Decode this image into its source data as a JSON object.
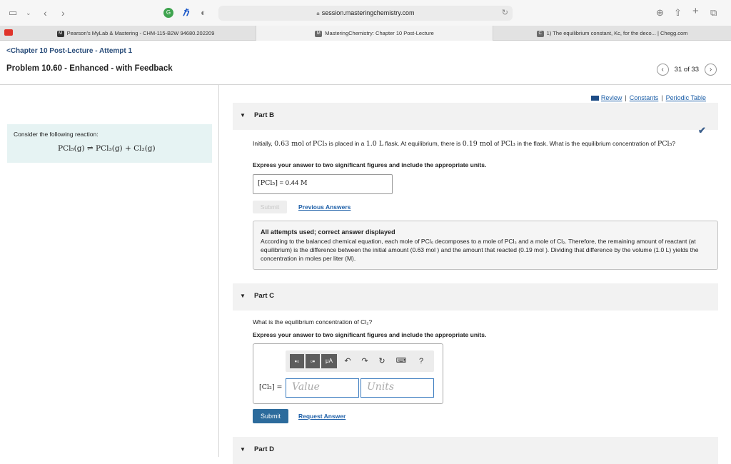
{
  "browser": {
    "url": "session.masteringchemistry.com",
    "tabs": [
      {
        "badge": "M",
        "label": "Pearson's MyLab & Mastering - CHM-115-B2W 94680.202209"
      },
      {
        "badge": "M",
        "label": "MasteringChemistry: Chapter 10 Post-Lecture"
      },
      {
        "badge": "C",
        "label": "1) The equilibrium constant, Kc, for the deco... | Chegg.com"
      }
    ]
  },
  "header": {
    "breadcrumb": "<Chapter 10 Post-Lecture - Attempt 1",
    "title": "Problem 10.60 - Enhanced - with Feedback",
    "pager": "31 of 33"
  },
  "intro": {
    "text": "Consider the following reaction:",
    "equation": "PCl₅(g) ⇌ PCl₃(g) + Cl₂(g)"
  },
  "links": {
    "review": "Review",
    "constants": "Constants",
    "periodic": "Periodic Table",
    "sep": "|"
  },
  "partB": {
    "label": "Part B",
    "q_intro": "Initially, ",
    "q_amt1": "0.63 mol",
    "q_of1": " of ",
    "q_species1": "PCl₅",
    "q_mid1": " is placed in a ",
    "q_vol": "1.0 L",
    "q_mid2": " flask. At equilibrium, there is ",
    "q_amt2": "0.19 mol",
    "q_of2": " of ",
    "q_species2": "PCl₃",
    "q_mid3": " in the flask. What is the equilibrium concentration of ",
    "q_species3": "PCl₅",
    "q_end": "?",
    "instruction": "Express your answer to two significant figures and include the appropriate units.",
    "answer_label": "[PCl₅]",
    "answer_eq": " = ",
    "answer_value": "0.44",
    "answer_unit": "M",
    "submit_label": "Submit",
    "previous_label": "Previous Answers",
    "feedback_head": "All attempts used; correct answer displayed",
    "feedback_text": "According to the balanced chemical equation, each mole of PCl₅ decomposes to a mole of PCl₃ and a mole of Cl₂. Therefore, the remaining amount of reactant (at equilibrium) is the difference between the initial amount (0.63 mol ) and the amount that reacted (0.19 mol ). Dividing that difference by the volume (1.0 L) yields the concentration in moles per liter (M)."
  },
  "partC": {
    "label": "Part C",
    "question": "What is the equilibrium concentration of Cl₂?",
    "instruction": "Express your answer to two significant figures and include the appropriate units.",
    "field_label": "[Cl₂] =",
    "value_placeholder": "Value",
    "units_placeholder": "Units",
    "mu_label": "μA",
    "help_label": "?",
    "submit_label": "Submit",
    "request_label": "Request Answer"
  },
  "partD": {
    "label": "Part D"
  }
}
